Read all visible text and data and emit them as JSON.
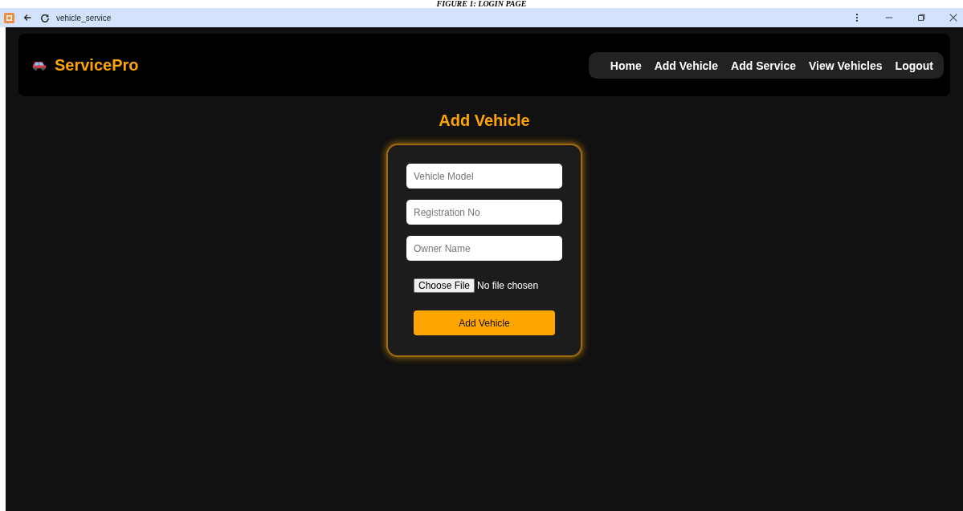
{
  "caption": "FIGURE 1: LOGIN PAGE",
  "browser": {
    "title": "vehicle_service"
  },
  "navbar": {
    "brand": "ServicePro",
    "links": [
      {
        "label": "Home"
      },
      {
        "label": "Add Vehicle"
      },
      {
        "label": "Add Service"
      },
      {
        "label": "View Vehicles"
      },
      {
        "label": "Logout"
      }
    ]
  },
  "form": {
    "title": "Add Vehicle",
    "fields": [
      {
        "placeholder": "Vehicle Model"
      },
      {
        "placeholder": "Registration No"
      },
      {
        "placeholder": "Owner Name"
      }
    ],
    "file": {
      "button": "Choose File",
      "status": "No file chosen"
    },
    "submit": "Add Vehicle"
  }
}
